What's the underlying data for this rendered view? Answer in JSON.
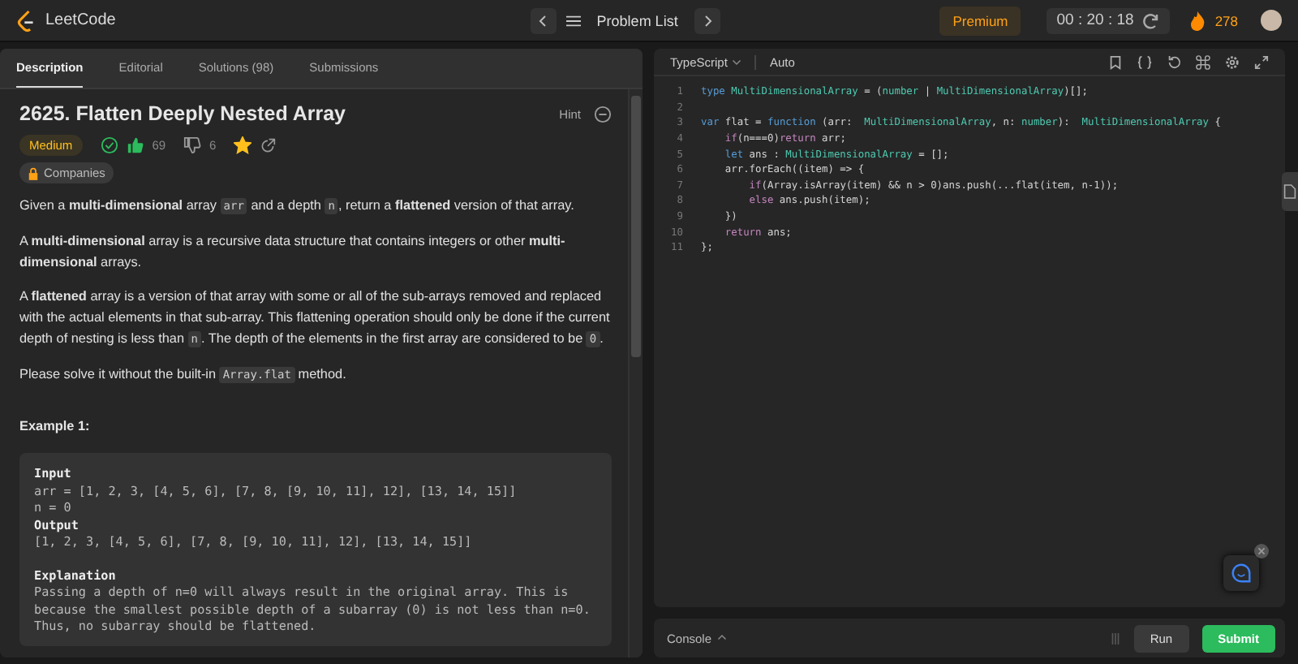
{
  "nav": {
    "logo": "LeetCode",
    "problem_list": "Problem List",
    "premium": "Premium",
    "timer": "00 : 20 : 18",
    "streak": "278"
  },
  "tabs": [
    {
      "label": "Description",
      "selected": true
    },
    {
      "label": "Editorial",
      "selected": false
    },
    {
      "label": "Solutions (98)",
      "selected": false
    },
    {
      "label": "Submissions",
      "selected": false
    }
  ],
  "problem": {
    "title": "2625. Flatten Deeply Nested Array",
    "hint": "Hint",
    "difficulty": "Medium",
    "solved": true,
    "likes": "69",
    "dislikes": "6",
    "starred": true,
    "companies": "Companies"
  },
  "paragraphs": [
    [
      {
        "kind": "text",
        "text": "Given a **multi-dimensional** array "
      },
      {
        "kind": "code",
        "text": "arr"
      },
      {
        "kind": "text",
        "text": " and a depth "
      },
      {
        "kind": "code",
        "text": "n"
      },
      {
        "kind": "text",
        "text": ", return a **flattened** version of that array."
      }
    ],
    [
      {
        "kind": "text",
        "text": "A **multi-dimensional** array is a recursive data structure that contains integers or other **multi-dimensional** arrays."
      }
    ],
    [
      {
        "kind": "text",
        "text": "A **flattened** array is a version of that array with some or all of the sub-arrays removed and replaced with the actual elements in that sub-array. This flattening operation should only be done if the current depth of nesting is less than "
      },
      {
        "kind": "code",
        "text": "n"
      },
      {
        "kind": "text",
        "text": ". The depth of the elements in the first array are considered to be "
      },
      {
        "kind": "code",
        "text": "0"
      },
      {
        "kind": "text",
        "text": "."
      }
    ],
    [
      {
        "kind": "text",
        "text": "Please solve it without the built-in "
      },
      {
        "kind": "code",
        "text": "Array.flat"
      },
      {
        "kind": "text",
        "text": " method."
      }
    ]
  ],
  "example": {
    "title": "Example 1:",
    "lines": [
      {
        "kind": "heading",
        "text": "Input"
      },
      {
        "kind": "line",
        "text": "arr = [1, 2, 3, [4, 5, 6], [7, 8, [9, 10, 11], 12], [13, 14, 15]]"
      },
      {
        "kind": "line",
        "text": "n = 0"
      },
      {
        "kind": "heading",
        "text": "Output"
      },
      {
        "kind": "line",
        "text": "[1, 2, 3, [4, 5, 6], [7, 8, [9, 10, 11], 12], [13, 14, 15]]"
      },
      {
        "kind": "gap"
      },
      {
        "kind": "heading",
        "text": "Explanation"
      },
      {
        "kind": "line",
        "text": "Passing a depth of n=0 will always result in the original array. This is"
      },
      {
        "kind": "line",
        "text": "because the smallest possible depth of a subarray (0) is not less than n=0."
      },
      {
        "kind": "line",
        "text": "Thus, no subarray should be flattened."
      }
    ]
  },
  "editor": {
    "language": "TypeScript",
    "mode": "Auto",
    "lines": [
      {
        "number": "1",
        "tokens": [
          {
            "kind": "kw",
            "text": "type "
          },
          {
            "kind": "type",
            "text": "MultiDimensionalArray"
          },
          {
            "kind": "plain",
            "text": " = ("
          },
          {
            "kind": "type",
            "text": "number"
          },
          {
            "kind": "plain",
            "text": " | "
          },
          {
            "kind": "type",
            "text": "MultiDimensionalArray"
          },
          {
            "kind": "plain",
            "text": ")[];"
          }
        ]
      },
      {
        "number": "2"
      },
      {
        "number": "3",
        "tokens": [
          {
            "kind": "kw",
            "text": "var"
          },
          {
            "kind": "plain",
            "text": " flat = "
          },
          {
            "kind": "kw",
            "text": "function"
          },
          {
            "kind": "plain",
            "text": " (arr:  "
          },
          {
            "kind": "type",
            "text": "MultiDimensionalArray"
          },
          {
            "kind": "plain",
            "text": ", n: "
          },
          {
            "kind": "type",
            "text": "number"
          },
          {
            "kind": "plain",
            "text": "):  "
          },
          {
            "kind": "type",
            "text": "MultiDimensionalArray"
          },
          {
            "kind": "plain",
            "text": " {"
          }
        ]
      },
      {
        "number": "4",
        "tokens": [
          {
            "kind": "ctl",
            "text": "    if"
          },
          {
            "kind": "plain",
            "text": "(n===0)"
          },
          {
            "kind": "ctl",
            "text": "return"
          },
          {
            "kind": "plain",
            "text": " arr;"
          }
        ]
      },
      {
        "number": "5",
        "tokens": [
          {
            "kind": "kw",
            "text": "    let"
          },
          {
            "kind": "plain",
            "text": " ans : "
          },
          {
            "kind": "type",
            "text": "MultiDimensionalArray"
          },
          {
            "kind": "plain",
            "text": " = [];"
          }
        ]
      },
      {
        "number": "6",
        "tokens": [
          {
            "kind": "plain",
            "text": "    arr.forEach((item) => {"
          }
        ]
      },
      {
        "number": "7",
        "tokens": [
          {
            "kind": "ctl",
            "text": "        if"
          },
          {
            "kind": "plain",
            "text": "(Array.isArray(item) && n > 0)ans.push(...flat(item, n-1));"
          }
        ]
      },
      {
        "number": "8",
        "tokens": [
          {
            "kind": "ctl",
            "text": "        else"
          },
          {
            "kind": "plain",
            "text": " ans.push(item);"
          }
        ]
      },
      {
        "number": "9",
        "tokens": [
          {
            "kind": "plain",
            "text": "    })"
          }
        ]
      },
      {
        "number": "10",
        "tokens": [
          {
            "kind": "ctl",
            "text": "    return"
          },
          {
            "kind": "plain",
            "text": " ans;"
          }
        ]
      },
      {
        "number": "11",
        "tokens": [
          {
            "kind": "plain",
            "text": "};"
          }
        ]
      }
    ]
  },
  "console": {
    "label": "Console",
    "run": "Run",
    "submit": "Submit"
  }
}
